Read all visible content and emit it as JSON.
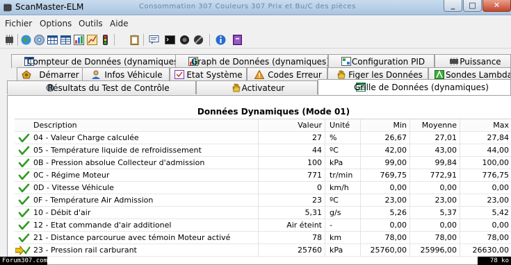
{
  "window": {
    "title": "ScanMaster-ELM",
    "ghost_title_text": "Consommation 307    Couleurs 307    Prix et Bu/C des pièces",
    "min_glyph": "_",
    "max_glyph": "□",
    "close_glyph": "✕"
  },
  "menu": [
    "Fichier",
    "Options",
    "Outils",
    "Aide"
  ],
  "toolbar": {
    "icons": [
      "chip-icon",
      "globe-icon",
      "disc-icon",
      "table-icon",
      "table-grid-icon",
      "chart-icon",
      "traffic-light-icon",
      "clipboard-icon",
      "chat-icon",
      "terminal-icon",
      "record-icon",
      "stop-icon",
      "info-icon",
      "book-icon"
    ]
  },
  "tabs": {
    "row1": [
      {
        "label": "Compteur de Données (dynamiques)",
        "icon": "table-icon"
      },
      {
        "label": "Graph de Données (dynamiques)",
        "icon": "chart-icon"
      },
      {
        "label": "Configuration PID",
        "icon": "config-icon"
      },
      {
        "label": "Puissance",
        "icon": "chip-icon"
      }
    ],
    "row2": [
      {
        "label": "Démarrer",
        "icon": "engine-icon"
      },
      {
        "label": "Infos Véhicule",
        "icon": "person-icon"
      },
      {
        "label": "Etat Système",
        "icon": "checklist-icon"
      },
      {
        "label": "Codes Erreur",
        "icon": "warning-icon"
      },
      {
        "label": "Figer les Données",
        "icon": "hand-icon"
      },
      {
        "label": "Sondes Lambda",
        "icon": "lambda-icon"
      }
    ],
    "row3": [
      {
        "label": "Résultats du Test de Contrôle",
        "icon": "gear-icon"
      },
      {
        "label": "Activateur",
        "icon": "hand-icon"
      },
      {
        "label": "Grille de Données (dynamiques)",
        "icon": "grid-icon",
        "active": true
      }
    ]
  },
  "grid": {
    "title": "Données Dynamiques (Mode 01)",
    "headers": {
      "description": "Description",
      "value": "Valeur",
      "unit": "Unité",
      "min": "Min",
      "avg": "Moyenne",
      "max": "Max"
    },
    "rows": [
      {
        "icon": "check-icon",
        "description": "04 - Valeur Charge calculée",
        "value": "27",
        "unit": "%",
        "min": "26,67",
        "avg": "27,01",
        "max": "27,84"
      },
      {
        "icon": "check-icon",
        "description": "05 - Température liquide de refroidissement",
        "value": "44",
        "unit": "ºC",
        "min": "42,00",
        "avg": "43,00",
        "max": "44,00"
      },
      {
        "icon": "check-icon",
        "description": "0B - Pression absolue Collecteur d'admission",
        "value": "100",
        "unit": "kPa",
        "min": "99,00",
        "avg": "99,84",
        "max": "100,00"
      },
      {
        "icon": "check-icon",
        "description": "0C - Régime Moteur",
        "value": "771",
        "unit": "tr/min",
        "min": "769,75",
        "avg": "772,91",
        "max": "776,75"
      },
      {
        "icon": "check-icon",
        "description": "0D - Vitesse Véhicule",
        "value": "0",
        "unit": "km/h",
        "min": "0,00",
        "avg": "0,00",
        "max": "0,00"
      },
      {
        "icon": "check-icon",
        "description": "0F - Température Air Admission",
        "value": "23",
        "unit": "ºC",
        "min": "23,00",
        "avg": "23,00",
        "max": "23,00"
      },
      {
        "icon": "check-icon",
        "description": "10 - Débit d'air",
        "value": "5,31",
        "unit": "g/s",
        "min": "5,26",
        "avg": "5,37",
        "max": "5,42"
      },
      {
        "icon": "check-icon",
        "description": "12 - Etat commande d'air additionel",
        "value": "Air éteint",
        "unit": "-",
        "min": "0,00",
        "avg": "0,00",
        "max": "0,00"
      },
      {
        "icon": "check-icon",
        "description": "21 - Distance parcourue avec témoin Moteur activé",
        "value": "78",
        "unit": "km",
        "min": "78,00",
        "avg": "78,00",
        "max": "78,00"
      },
      {
        "icon": "arrow-check-icon",
        "description": "23 - Pression rail carburant",
        "value": "25760",
        "unit": "kPa",
        "min": "25760,00",
        "avg": "25996,00",
        "max": "26630,00"
      }
    ]
  },
  "watermark": {
    "left": "Forum307.com",
    "right": "78 ko"
  },
  "colors": {
    "check_green": "#2e9a1f",
    "arrow_yellow": "#f2c200",
    "titlebar": "#b9d1ea"
  }
}
